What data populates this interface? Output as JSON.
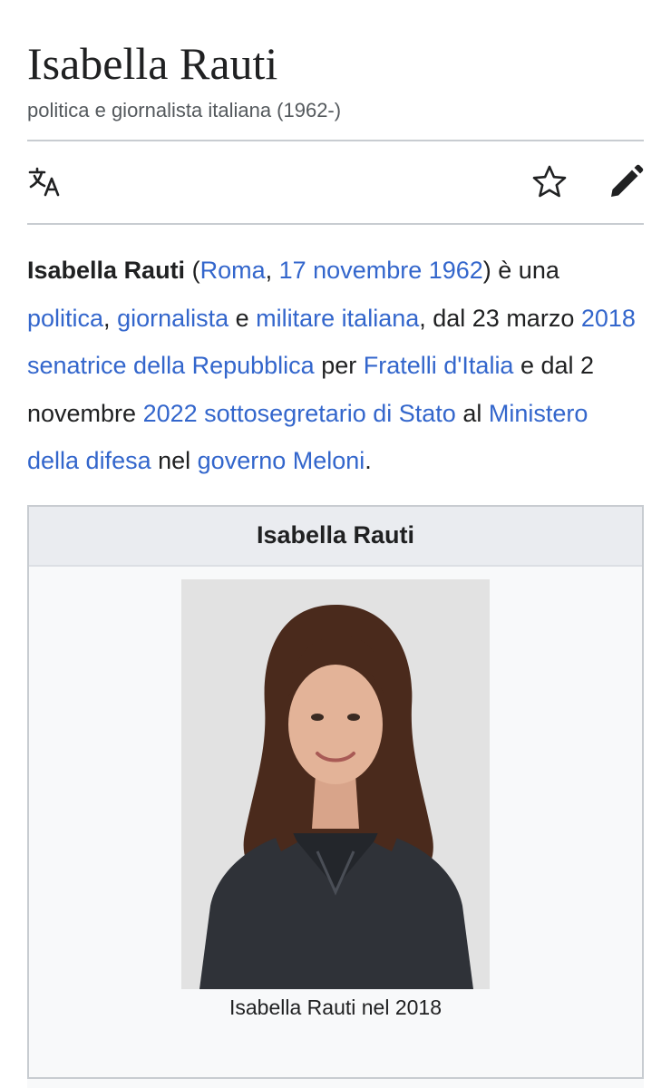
{
  "page": {
    "title": "Isabella Rauti",
    "subtitle": "politica e giornalista italiana (1962-)"
  },
  "toolbar": {
    "icons": [
      "language-icon",
      "star-icon",
      "pencil-icon"
    ]
  },
  "intro": {
    "name": "Isabella Rauti",
    "t1": " (",
    "l_roma": "Roma",
    "t2": ", ",
    "l_date": "17 novembre 1962",
    "t3": ") è una ",
    "l_politica": "politica",
    "t4": ", ",
    "l_giornalista": "giornalista",
    "t5": " e ",
    "l_militare": "militare italiana",
    "t6": ", dal 23 marzo ",
    "l_senatrice": "2018 senatrice della Repubblica",
    "t7": " per ",
    "l_fdi": "Fratelli d'Italia",
    "t8": " e dal 2 novembre ",
    "l_sottosegretario": "2022 sottosegretario di Stato",
    "t9": " al ",
    "l_ministero": "Ministero della difesa",
    "t10": " nel ",
    "l_governo": "governo Meloni",
    "t11": "."
  },
  "infobox": {
    "header": "Isabella Rauti",
    "caption": "Isabella Rauti nel 2018"
  },
  "colors": {
    "link": "#3366cc",
    "text": "#202122",
    "muted": "#54595d",
    "divider": "#c8ccd1",
    "infobox_header_bg": "#eaecf0"
  }
}
